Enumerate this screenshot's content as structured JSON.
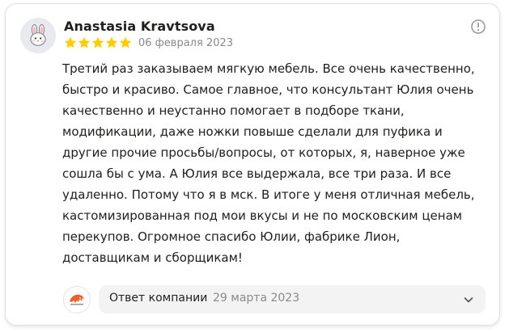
{
  "review": {
    "author": "Anastasia Kravtsova",
    "rating": 5,
    "date": "06 февраля 2023",
    "avatar_icon": "rabbit-icon",
    "text": "Третий раз заказываем мягкую мебель. Все очень качественно, быстро и красиво. Самое главное, что консультант Юлия очень качественно и неустанно помогает в подборе ткани, модификации, даже ножки повыше сделали для пуфика и другие прочие просьбы/вопросы, от которых, я, наверное уже сошла бы с ума. А Юлия все выдержала, все три раза. И все удаленно. Потому что я в мск. В итоге у меня отличная мебель, кастомизированная под мои вкусы и не по московским ценам перекупов. Огромное спасибо Юлии, фабрике Лион, доставщикам и сборщикам!"
  },
  "reply": {
    "label": "Ответ компании",
    "date": "29 марта 2023",
    "logo_icon": "lion-logo-icon",
    "expand_icon": "chevron-down-icon"
  },
  "colors": {
    "star": "#fc0",
    "text": "#21201f",
    "muted": "#8a8a8a",
    "reply_bg": "#f3f3f3",
    "logo_accent": "#e8622a"
  },
  "icons": {
    "info": "info-icon"
  }
}
